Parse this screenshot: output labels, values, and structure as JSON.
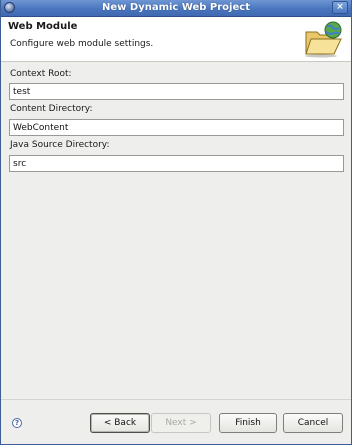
{
  "window": {
    "title": "New Dynamic Web Project",
    "close_glyph": "×"
  },
  "banner": {
    "heading": "Web Module",
    "description": "Configure web module settings.",
    "icon": "folder-globe-icon"
  },
  "fields": {
    "context_root": {
      "label": "Context Root:",
      "value": "test"
    },
    "content_directory": {
      "label": "Content Directory:",
      "value": "WebContent"
    },
    "java_source_directory": {
      "label": "Java Source Directory:",
      "value": "src"
    }
  },
  "buttons": {
    "help_glyph": "?",
    "back": "< Back",
    "next": "Next >",
    "finish": "Finish",
    "cancel": "Cancel"
  },
  "colors": {
    "titlebar": "#4a76bf",
    "dialog_bg": "#eeeeec",
    "banner_bg": "#ffffff"
  }
}
